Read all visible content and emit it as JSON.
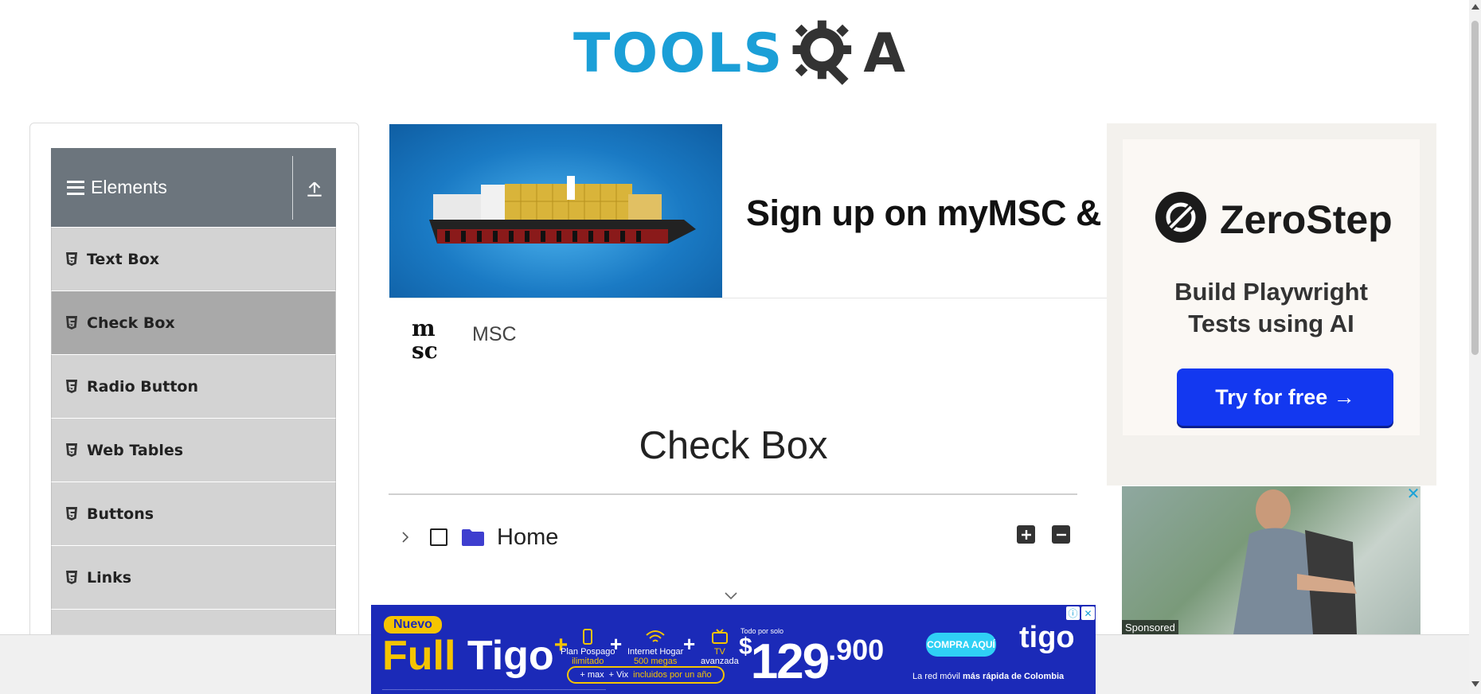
{
  "header": {
    "logo_text_a": "TOOLS",
    "logo_text_b": "A"
  },
  "sidebar": {
    "group_title": "Elements",
    "items": [
      {
        "label": "Text Box",
        "active": false
      },
      {
        "label": "Check Box",
        "active": true
      },
      {
        "label": "Radio Button",
        "active": false
      },
      {
        "label": "Web Tables",
        "active": false
      },
      {
        "label": "Buttons",
        "active": false
      },
      {
        "label": "Links",
        "active": false
      }
    ]
  },
  "ad_main": {
    "headline": "Sign up on myMSC & B",
    "advertiser": "MSC"
  },
  "main": {
    "title": "Check Box",
    "tree": {
      "root_label": "Home",
      "expand_all_icon": "plus-square-icon",
      "collapse_all_icon": "minus-square-icon"
    }
  },
  "ad_right": {
    "brand": "ZeroStep",
    "tagline_1": "Build Playwright",
    "tagline_2": "Tests using AI",
    "cta": "Try for free →",
    "close": "✕",
    "sponsored": "Sponsored"
  },
  "ad_bottom": {
    "badge": "Nuevo",
    "product_a": "Full ",
    "product_b": "Tigo",
    "product_plus": "+",
    "feature_1a": "Plan Pospago",
    "feature_1b": "ilimitado",
    "feature_2a": "Internet Hogar",
    "feature_2b": "500 megas",
    "feature_3a": "TV",
    "feature_3b": "avanzada",
    "pill_a": "+ max",
    "pill_b": "+ Vix",
    "pill_c": "incluidos por un año",
    "price_label": "Todo por solo",
    "currency": "$",
    "price_main": "129",
    "price_cents": ".900",
    "cta": "COMPRA AQUÍ",
    "brand": "tigo",
    "slogan_a": "La red móvil ",
    "slogan_b": "más rápida de Colombia",
    "info": "ⓘ",
    "close": "✕"
  },
  "colors": {
    "tools_blue": "#1b9fd7",
    "sidebar_header": "#6c757d",
    "sidebar_item": "#d3d3d3",
    "sidebar_active": "#a9a9a9",
    "folder": "#3e3ecf",
    "zerostep_cta": "#1338f0",
    "tigo_blue": "#1b2ab8",
    "tigo_yellow": "#f5c400"
  }
}
